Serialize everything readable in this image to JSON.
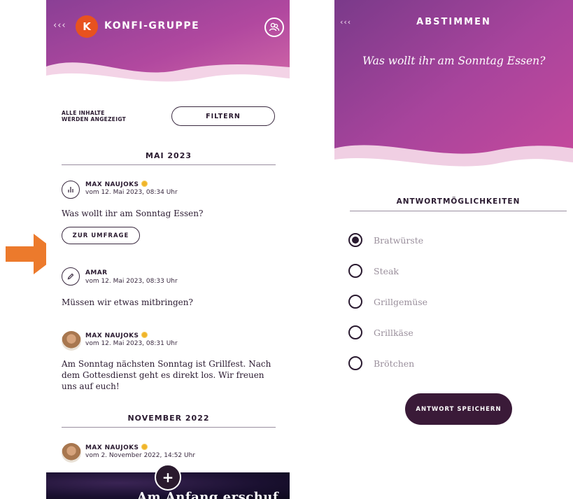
{
  "left_screen": {
    "back_glyph": "‹‹‹",
    "group_avatar_letter": "K",
    "group_title": "KONFI-GRUPPE",
    "filter_note_line1": "ALLE INHALTE",
    "filter_note_line2": "WERDEN ANGEZEIGT",
    "filter_button": "FILTERN",
    "sections": [
      {
        "month": "MAI 2023",
        "posts": [
          {
            "icon": "poll-icon",
            "author": "MAX NAUJOKS",
            "verified": true,
            "time": "vom 12. Mai 2023, 08:34 Uhr",
            "text": "Was wollt ihr am Sonntag Essen?",
            "action": "ZUR UMFRAGE"
          },
          {
            "icon": "pencil-icon",
            "author": "AMAR",
            "verified": false,
            "time": "vom 12. Mai 2023, 08:33 Uhr",
            "text": "Müssen wir etwas mitbringen?"
          },
          {
            "icon": "user-photo",
            "author": "MAX NAUJOKS",
            "verified": true,
            "time": "vom 12. Mai 2023, 08:31 Uhr",
            "text": "Am Sonntag nächsten Sonntag ist Grillfest. Nach dem Gottesdienst geht es direkt los. Wir freuen uns auf euch!"
          }
        ]
      },
      {
        "month": "NOVEMBER 2022",
        "posts": [
          {
            "icon": "user-photo",
            "author": "MAX NAUJOKS",
            "verified": true,
            "time": "vom 2. November 2022, 14:52 Uhr"
          }
        ]
      }
    ],
    "fab_label": "+",
    "footer_banner_text": "Am Anfang erschuf"
  },
  "right_screen": {
    "back_glyph": "‹‹‹",
    "title": "ABSTIMMEN",
    "question": "Was wollt ihr am Sonntag Essen?",
    "options_heading": "ANTWORTMÖGLICHKEITEN",
    "options": [
      {
        "label": "Bratwürste",
        "selected": true
      },
      {
        "label": "Steak",
        "selected": false
      },
      {
        "label": "Grillgemüse",
        "selected": false
      },
      {
        "label": "Grillkäse",
        "selected": false
      },
      {
        "label": "Brötchen",
        "selected": false
      }
    ],
    "save_button": "ANTWORT SPEICHERN"
  },
  "colors": {
    "hero_purple": "#7a3a8a",
    "hero_pink": "#c94a9c",
    "accent_orange": "#e8521f",
    "dark_button": "#3a1a38",
    "arrow_orange": "#ec7a2c"
  }
}
